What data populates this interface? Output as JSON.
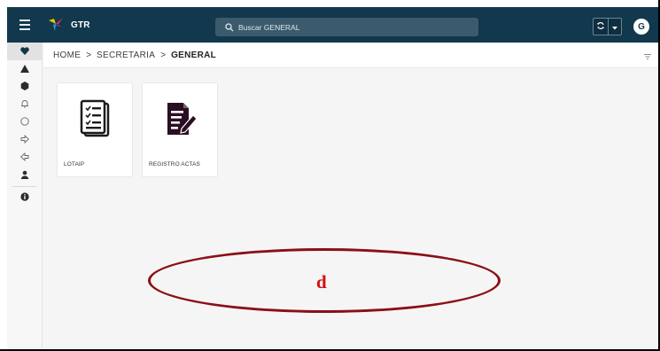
{
  "app": {
    "title": "GTR"
  },
  "search": {
    "placeholder": "Buscar GENERAL"
  },
  "user": {
    "avatar_initial": "G"
  },
  "breadcrumb": [
    "HOME",
    "SECRETARIA",
    "GENERAL"
  ],
  "breadcrumb_separator": ">",
  "sidebar": {
    "items": [
      {
        "icon": "heart-icon",
        "active": true
      },
      {
        "icon": "triangle-icon",
        "active": false
      },
      {
        "icon": "hexagon-icon",
        "active": false
      },
      {
        "icon": "bell-icon",
        "active": false
      },
      {
        "icon": "circle-icon",
        "active": false
      },
      {
        "icon": "arrow-right-icon",
        "active": false
      },
      {
        "icon": "arrow-left-icon",
        "active": false
      },
      {
        "icon": "user-icon",
        "active": false
      },
      {
        "icon": "info-icon",
        "active": false
      }
    ]
  },
  "tiles": [
    {
      "label": "LOTAIP",
      "icon": "checklist-document-icon"
    },
    {
      "label": "REGISTRO ACTAS",
      "icon": "document-edit-icon"
    }
  ],
  "annotation": {
    "letter": "d"
  },
  "colors": {
    "topbar": "#11384d",
    "search_bg": "#3b5b6c",
    "annotation_ring": "#8b0f17",
    "annotation_letter": "#d10f0f",
    "tile_icon_dark": "#2a0f23"
  }
}
